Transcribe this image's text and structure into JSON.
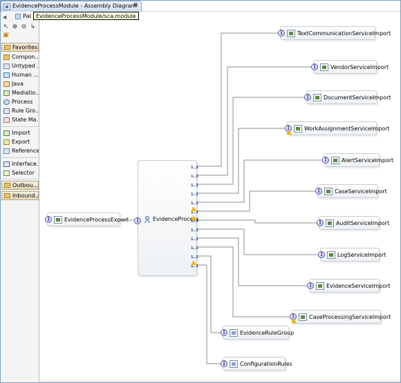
{
  "window": {
    "tab_title": "EvidenceProcessModule - Assembly Diagram",
    "close_glyph": "✖",
    "tooltip": "EvidenceProcessModule/sca.module"
  },
  "palette": {
    "title": "Pal",
    "collapse_glyph": "◀",
    "drawers": {
      "favorites": "Favorites",
      "outbound": "Outbou...",
      "inbound": "Inbound..."
    },
    "items": {
      "components": "Compon...",
      "untyped": "Untyped ...",
      "human": "Human ...",
      "java": "Java",
      "mediation": "Mediatio...",
      "process": "Process",
      "rule_group": "Rule Gro...",
      "state_machine": "State Ma...",
      "import": "Import",
      "export": "Export",
      "references": "References",
      "interface": "Interface...",
      "selector": "Selector"
    }
  },
  "diagram": {
    "export": "EvidenceProcessExport",
    "component": "EvidenceProcess",
    "reference_multiplicity": "1..1",
    "interface_glyph": "I",
    "imports": {
      "text_communication": "TextCommunicationServiceImport",
      "vendor": "VendorServiceImport",
      "document": "DocumentServiceImport",
      "work_assignment": "WorkAssignmentServiceImport",
      "alert": "AlertServiceImport",
      "case": "CaseServiceImport",
      "audit": "AuditServiceImport",
      "log": "LogServiceImport",
      "evidence": "EvidenceServiceImport",
      "case_processing": "CaseProcessingServiceImport"
    },
    "rule_groups": {
      "evidence_rule_group": "EvidenceRuleGroup",
      "configuration_rules": "ConfigurationRules"
    }
  },
  "colors": {
    "frame_border": "#7f9db9",
    "tab_gradient_top": "#f1f5fb",
    "tab_gradient_bottom": "#cddcee",
    "drawer": "#e4d7b8",
    "wire": "#8c8c8c",
    "interface": "#5a5aa8",
    "warning": "#f2b600"
  }
}
